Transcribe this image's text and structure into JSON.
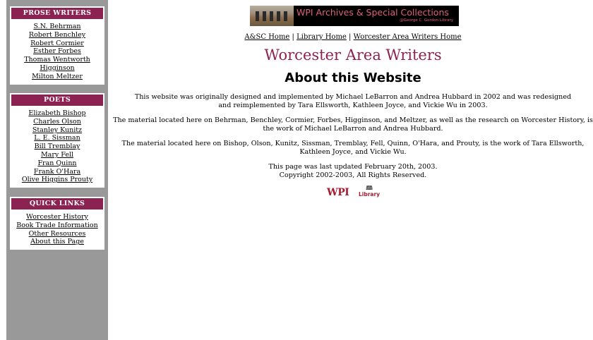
{
  "sidebar": {
    "sections": [
      {
        "title": "PROSE WRITERS",
        "links": [
          "S.N. Behrman",
          "Robert Benchley",
          "Robert Cormier",
          "Esther Forbes",
          "Thomas Wentworth",
          "Higginson",
          "Milton Meltzer"
        ]
      },
      {
        "title": "POETS",
        "links": [
          "Elizabeth Bishop",
          "Charles Olson",
          "Stanley Kunitz",
          "L. E. Sissman",
          "Bill Tremblay",
          "Mary Fell",
          "Fran Quinn",
          "Frank O'Hara",
          "Olive Higgins Prouty"
        ]
      },
      {
        "title": "QUICK LINKS",
        "links": [
          "Worcester History",
          "Book Trade Information",
          "Other Resources",
          "About this Page"
        ]
      }
    ]
  },
  "banner": {
    "title": "WPI Archives & Special Collections",
    "subtitle": "@George C. Gordon Library"
  },
  "nav": {
    "home": "A&SC Home",
    "library": "Library Home",
    "writers": "Worcester Area Writers Home",
    "sep": "|"
  },
  "site_title": "Worcester Area Writers",
  "page_title": "About this Website",
  "paragraphs": [
    "This website was originally designed and implemented by Michael LeBarron and Andrea Hubbard in 2002 and was redesigned and reimplemented by Tara Ellsworth, Kathleen Joyce, and Vickie Wu in 2003.",
    "The material located here on Behrman, Benchley, Cormier, Forbes, Higginson, and Meltzer, as well as the research on Worcester History, is the work of Michael LeBarron and Andrea Hubbard.",
    "The material located here on Bishop, Olson, Kunitz, Sissman, Tremblay, Fell, Quinn, O'Hara, and Prouty, is the work of Tara Ellsworth, Kathleen Joyce, and Vickie Wu."
  ],
  "updated": "This page was last updated February 20th, 2003.",
  "copyright": "Copyright 2002-2003, All Rights Reserved.",
  "logos": {
    "wpi": "WPI",
    "library": "Library",
    "library_icon": "book-icon"
  }
}
